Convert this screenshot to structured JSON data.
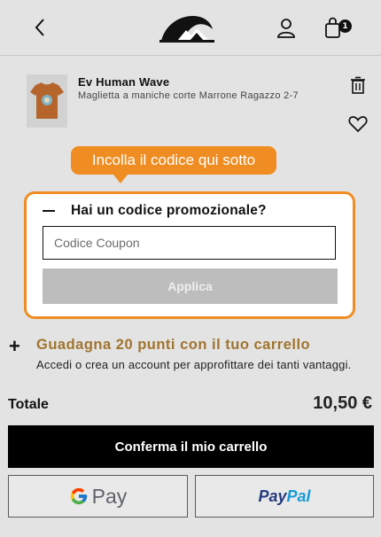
{
  "header": {
    "badge_count": "1"
  },
  "product": {
    "name": "Ev Human Wave",
    "description": "Maglietta a maniche corte Marrone Ragazzo 2-7"
  },
  "tooltip": {
    "text": "Incolla il codice qui sotto"
  },
  "promo": {
    "title": "Hai un codice promozionale?",
    "coupon_placeholder": "Codice Coupon",
    "coupon_value": "",
    "apply_label": "Applica"
  },
  "points": {
    "title": "Guadagna 20 punti con il tuo carrello",
    "text": "Accedi o crea un account per approfittare dei tanti vantaggi."
  },
  "total": {
    "label": "Totale",
    "value": "10,50 €"
  },
  "buttons": {
    "confirm": "Conferma il mio carrello",
    "gpay_label": "Pay",
    "paypal_part1": "Pay",
    "paypal_part2": "Pal"
  },
  "colors": {
    "accent_orange": "#ef8d22",
    "points_gold": "#a0742f",
    "background": "#e3e3e3"
  },
  "icons": [
    "back-icon",
    "quiksilver-logo",
    "user-icon",
    "bag-icon",
    "trash-icon",
    "heart-icon",
    "minus-icon",
    "plus-icon",
    "google-g-icon"
  ]
}
